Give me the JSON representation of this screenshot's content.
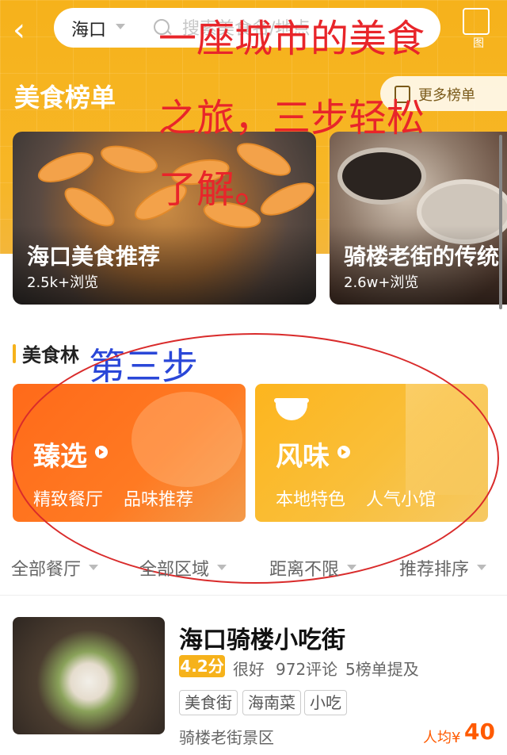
{
  "header": {
    "city": "海口",
    "search_placeholder": "搜索美食名/地点",
    "map_label": "图"
  },
  "ranking": {
    "title": "美食榜单",
    "more_label": "更多榜单",
    "cards": [
      {
        "title": "海口美食推荐",
        "views": "2.5k+浏览"
      },
      {
        "title": "骑楼老街的传统",
        "views": "2.6w+浏览"
      }
    ]
  },
  "overlay": {
    "line1": "一座城市的美食",
    "line2": "之旅，三步轻松",
    "line3": "了解。",
    "step": "第三步"
  },
  "section2": {
    "title": "美食林"
  },
  "categories": [
    {
      "title": "臻选",
      "desc1": "精致餐厅",
      "desc2": "品味推荐",
      "color": "#ff6a1a"
    },
    {
      "title": "风味",
      "desc1": "本地特色",
      "desc2": "人气小馆",
      "color": "#fdb51e"
    }
  ],
  "filters": [
    "全部餐厅",
    "全部区域",
    "距离不限",
    "推荐排序"
  ],
  "restaurant": {
    "name": "海口骑楼小吃街",
    "rating": "4.2分",
    "rating_text": "很好",
    "reviews": "972评论",
    "lists": "5榜单提及",
    "tags": [
      "美食街",
      "海南菜",
      "小吃"
    ],
    "area": "骑楼老街景区",
    "price_label": "人均¥",
    "price_value": "40"
  },
  "colors": {
    "accent": "#f6b21b",
    "orange": "#ff5a00",
    "annotation_red": "#e8252a",
    "annotation_blue": "#2a47d8"
  }
}
